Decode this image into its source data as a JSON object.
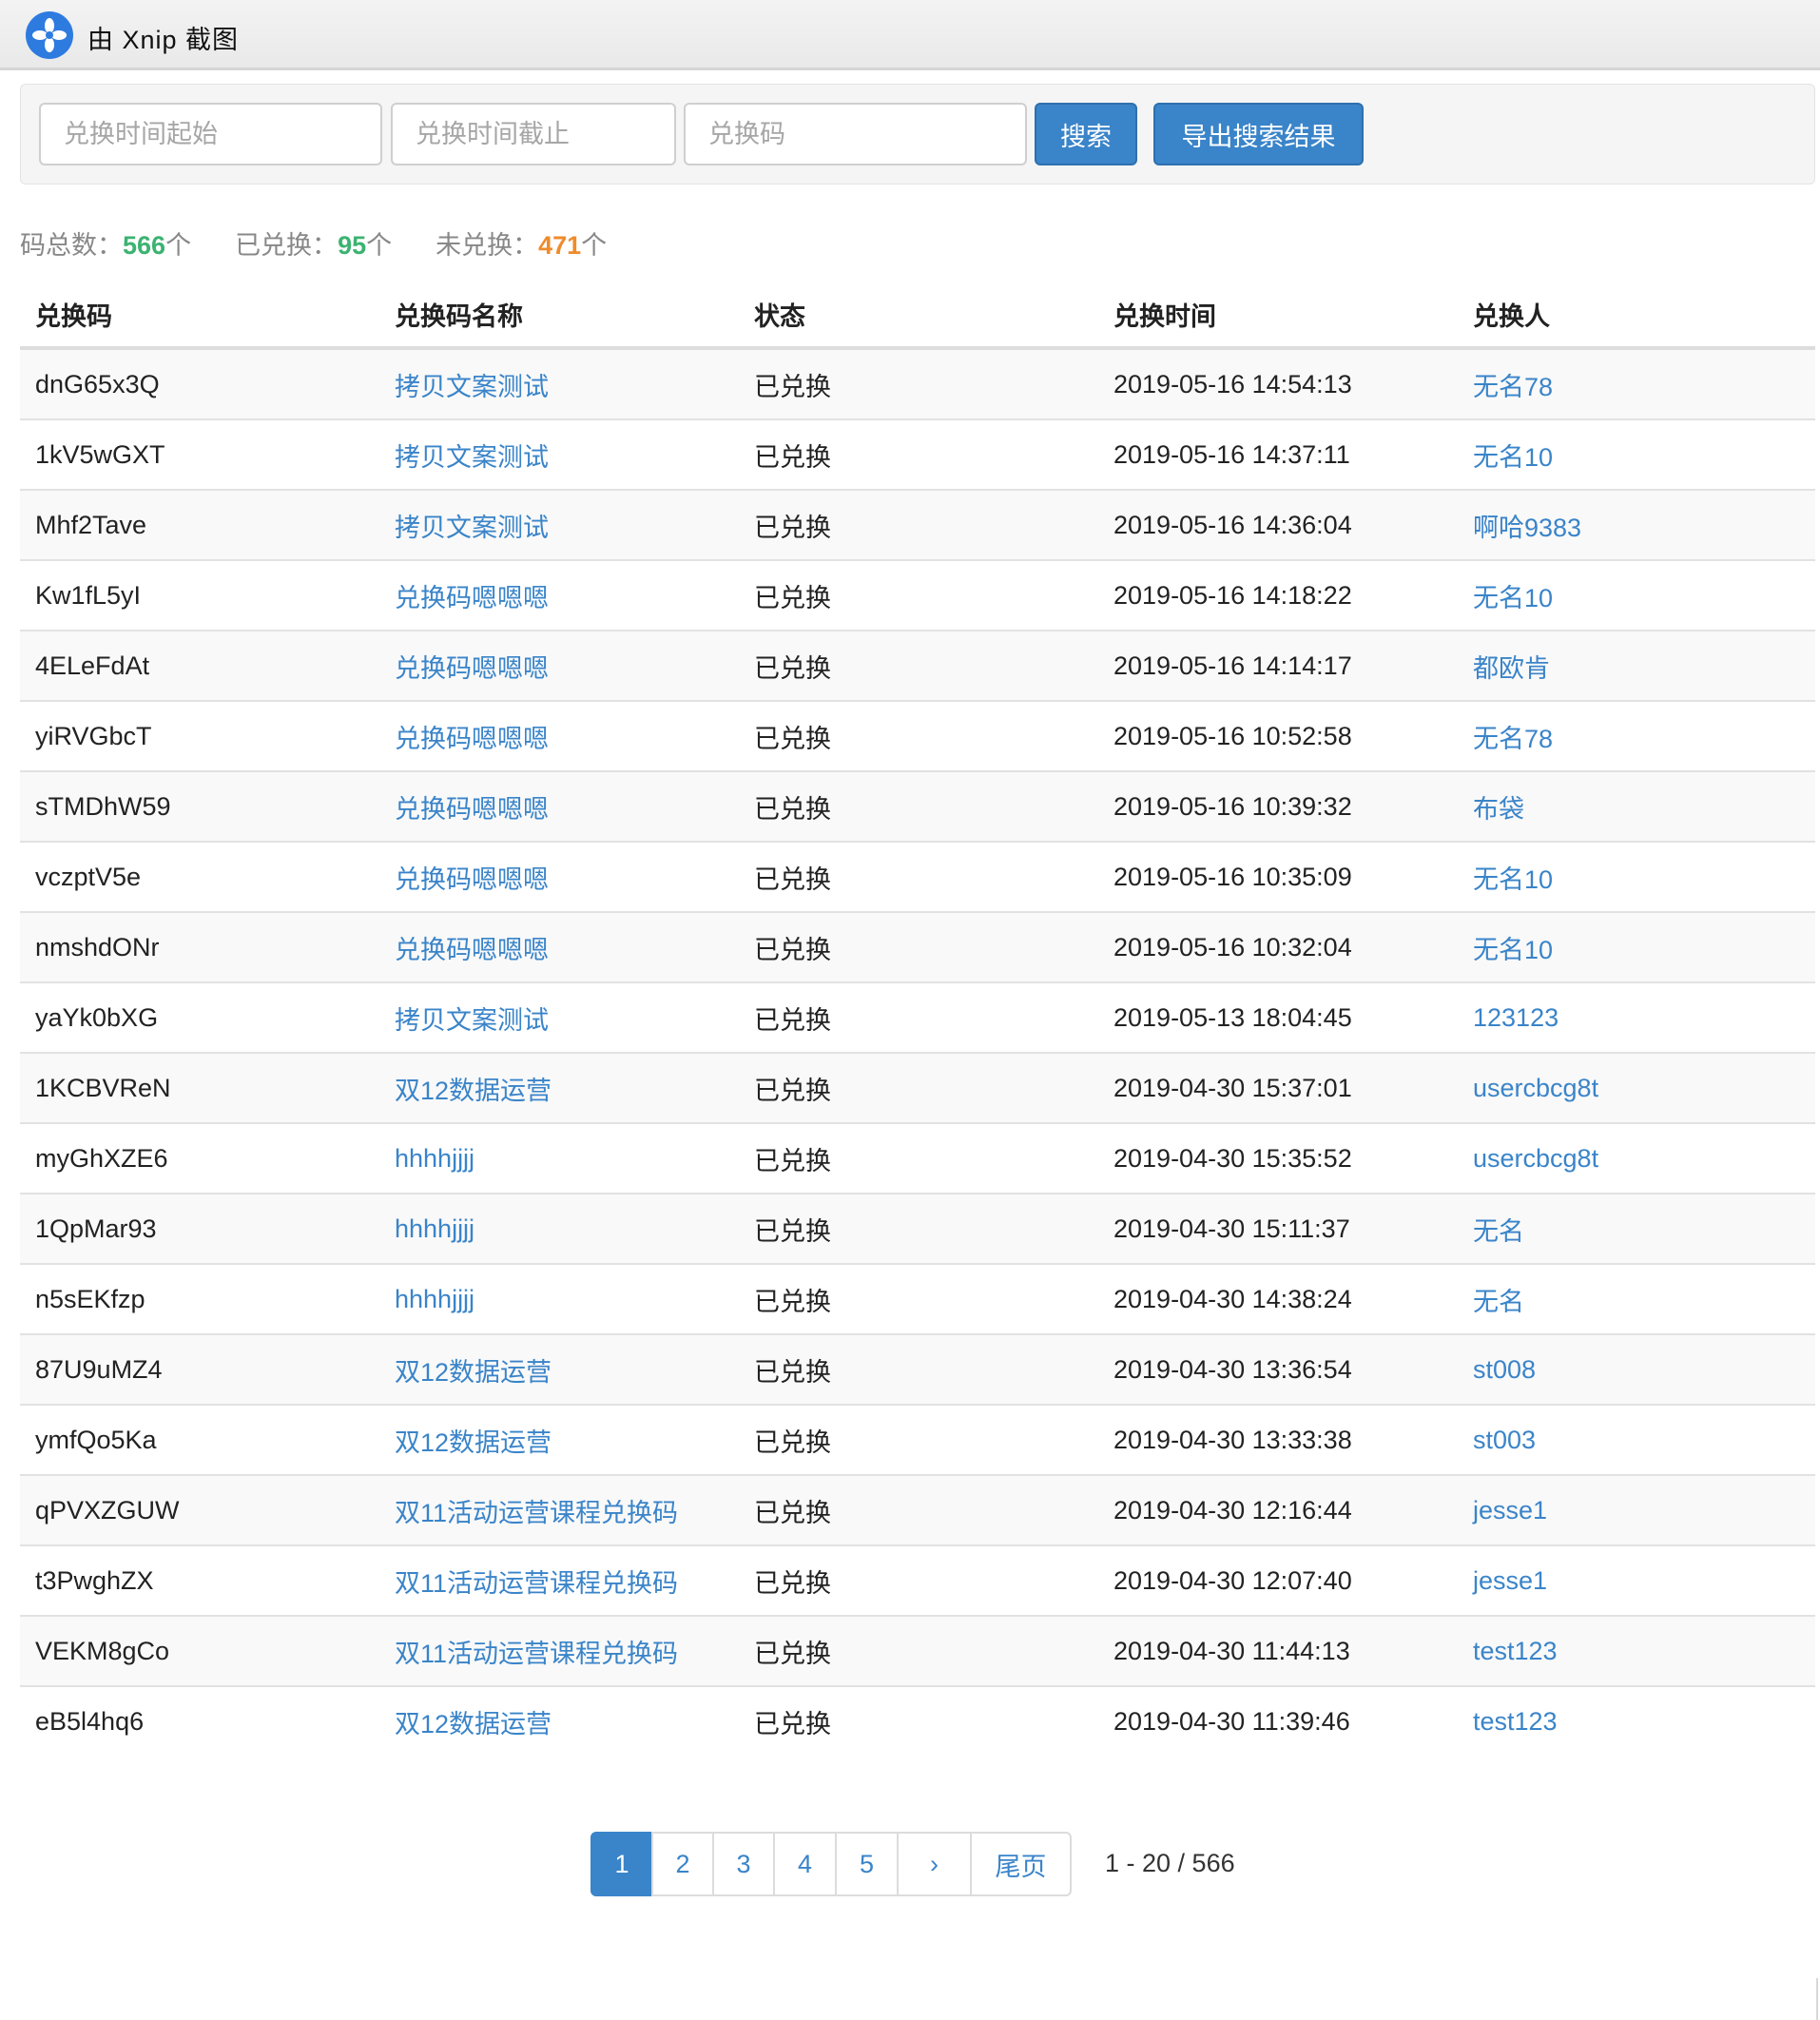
{
  "window": {
    "title": "由 Xnip 截图",
    "logo_icon": "xnip-logo-icon"
  },
  "search": {
    "start_placeholder": "兑换时间起始",
    "end_placeholder": "兑换时间截止",
    "code_placeholder": "兑换码",
    "search_label": "搜索",
    "export_label": "导出搜索结果"
  },
  "stats": {
    "total_label": "码总数：",
    "total_value": "566",
    "total_unit": "个",
    "redeemed_label": "已兑换：",
    "redeemed_value": "95",
    "redeemed_unit": "个",
    "unredeemed_label": "未兑换：",
    "unredeemed_value": "471",
    "unredeemed_unit": "个"
  },
  "table": {
    "headers": [
      "兑换码",
      "兑换码名称",
      "状态",
      "兑换时间",
      "兑换人"
    ],
    "rows": [
      [
        "dnG65x3Q",
        "拷贝文案测试",
        "已兑换",
        "2019-05-16 14:54:13",
        "无名78"
      ],
      [
        "1kV5wGXT",
        "拷贝文案测试",
        "已兑换",
        "2019-05-16 14:37:11",
        "无名10"
      ],
      [
        "Mhf2Tave",
        "拷贝文案测试",
        "已兑换",
        "2019-05-16 14:36:04",
        "啊哈9383"
      ],
      [
        "Kw1fL5yI",
        "兑换码嗯嗯嗯",
        "已兑换",
        "2019-05-16 14:18:22",
        "无名10"
      ],
      [
        "4ELeFdAt",
        "兑换码嗯嗯嗯",
        "已兑换",
        "2019-05-16 14:14:17",
        "都欧肯"
      ],
      [
        "yiRVGbcT",
        "兑换码嗯嗯嗯",
        "已兑换",
        "2019-05-16 10:52:58",
        "无名78"
      ],
      [
        "sTMDhW59",
        "兑换码嗯嗯嗯",
        "已兑换",
        "2019-05-16 10:39:32",
        "布袋"
      ],
      [
        "vczptV5e",
        "兑换码嗯嗯嗯",
        "已兑换",
        "2019-05-16 10:35:09",
        "无名10"
      ],
      [
        "nmshdONr",
        "兑换码嗯嗯嗯",
        "已兑换",
        "2019-05-16 10:32:04",
        "无名10"
      ],
      [
        "yaYk0bXG",
        "拷贝文案测试",
        "已兑换",
        "2019-05-13 18:04:45",
        "123123"
      ],
      [
        "1KCBVReN",
        "双12数据运营",
        "已兑换",
        "2019-04-30 15:37:01",
        "usercbcg8t"
      ],
      [
        "myGhXZE6",
        "hhhhjjjj",
        "已兑换",
        "2019-04-30 15:35:52",
        "usercbcg8t"
      ],
      [
        "1QpMar93",
        "hhhhjjjj",
        "已兑换",
        "2019-04-30 15:11:37",
        "无名"
      ],
      [
        "n5sEKfzp",
        "hhhhjjjj",
        "已兑换",
        "2019-04-30 14:38:24",
        "无名"
      ],
      [
        "87U9uMZ4",
        "双12数据运营",
        "已兑换",
        "2019-04-30 13:36:54",
        "st008"
      ],
      [
        "ymfQo5Ka",
        "双12数据运营",
        "已兑换",
        "2019-04-30 13:33:38",
        "st003"
      ],
      [
        "qPVXZGUW",
        "双11活动运营课程兑换码",
        "已兑换",
        "2019-04-30 12:16:44",
        "jesse1"
      ],
      [
        "t3PwghZX",
        "双11活动运营课程兑换码",
        "已兑换",
        "2019-04-30 12:07:40",
        "jesse1"
      ],
      [
        "VEKM8gCo",
        "双11活动运营课程兑换码",
        "已兑换",
        "2019-04-30 11:44:13",
        "test123"
      ],
      [
        "eB5l4hq6",
        "双12数据运营",
        "已兑换",
        "2019-04-30 11:39:46",
        "test123"
      ]
    ]
  },
  "pagination": {
    "pages": [
      "1",
      "2",
      "3",
      "4",
      "5"
    ],
    "active_page": "1",
    "next_label": "›",
    "last_label": "尾页",
    "range_text": "1 - 20 / 566"
  },
  "colors": {
    "accent": "#3a84c9",
    "green": "#3cb371",
    "orange": "#ef8b2c"
  }
}
